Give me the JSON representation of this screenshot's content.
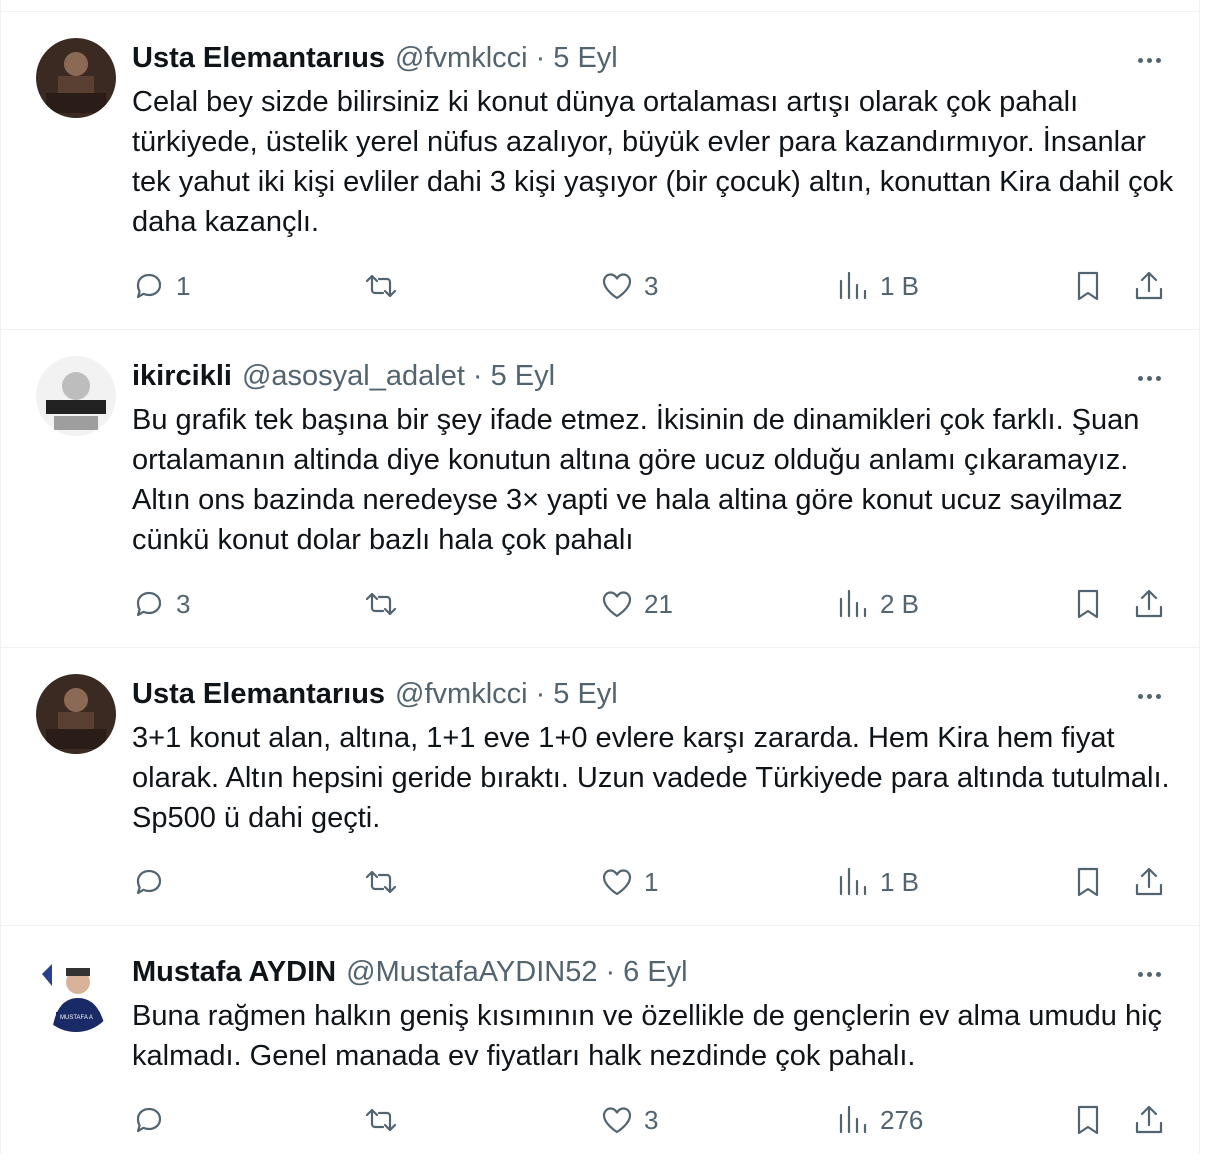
{
  "tweets": [
    {
      "display_name": "Usta Elemantarıus",
      "handle": "@fvmklcci",
      "separator": "·",
      "date": "5 Eyl",
      "text": "Celal bey sizde bilirsiniz ki konut dünya ortalaması artışı olarak çok pahalı türkiyede, üstelik yerel nüfus azalıyor, büyük evler para kazandırmıyor. İnsanlar tek yahut iki kişi evliler dahi 3 kişi yaşıyor (bir çocuk) altın, konuttan Kira dahil çok daha kazançlı.",
      "replies": "1",
      "retweets": "",
      "likes": "3",
      "views": "1 B"
    },
    {
      "display_name": "ikircikli",
      "handle": "@asosyal_adalet",
      "separator": "·",
      "date": "5 Eyl",
      "text": "Bu grafik tek başına bir şey ifade etmez. İkisinin de dinamikleri çok farklı. Şuan ortalamanın altinda diye konutun altına göre ucuz olduğu anlamı çıkaramayız. Altın ons bazinda neredeyse 3× yapti ve hala altina göre konut ucuz sayilmaz cünkü konut dolar bazlı hala çok pahalı",
      "replies": "3",
      "retweets": "",
      "likes": "21",
      "views": "2 B"
    },
    {
      "display_name": "Usta Elemantarıus",
      "handle": "@fvmklcci",
      "separator": "·",
      "date": "5 Eyl",
      "text": "3+1 konut alan, altına, 1+1 eve 1+0 evlere karşı zararda. Hem Kira hem fiyat olarak. Altın hepsini geride bıraktı. Uzun vadede Türkiyede para altında tutulmalı. Sp500 ü dahi geçti.",
      "replies": "",
      "retweets": "",
      "likes": "1",
      "views": "1 B"
    },
    {
      "display_name": "Mustafa AYDIN",
      "handle": "@MustafaAYDIN52",
      "separator": "·",
      "date": "6 Eyl",
      "text": "Buna rağmen halkın geniş kısımının ve özellikle de gençlerin ev alma umudu hiç kalmadı. Genel manada ev fiyatları halk nezdinde çok pahalı.",
      "replies": "",
      "retweets": "",
      "likes": "3",
      "views": "276"
    }
  ],
  "avatar_badge_text": "MUSTAFA A",
  "colors": {
    "text_primary": "#0f1419",
    "text_secondary": "#536471",
    "divider": "#eff3f4"
  },
  "icons": [
    "reply-icon",
    "retweet-icon",
    "like-icon",
    "views-icon",
    "bookmark-icon",
    "share-icon",
    "more-icon"
  ]
}
